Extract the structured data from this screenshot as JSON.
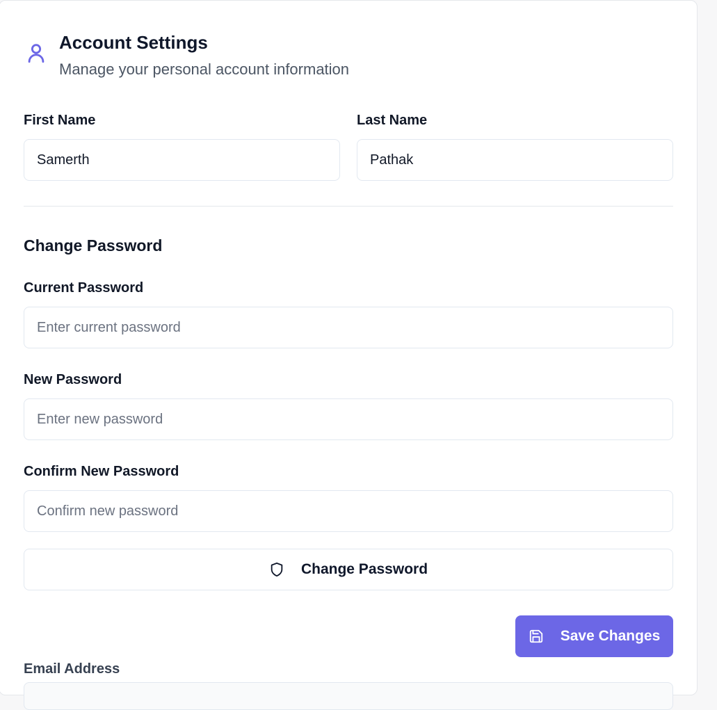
{
  "header": {
    "title": "Account Settings",
    "subtitle": "Manage your personal account information"
  },
  "name": {
    "first_label": "First Name",
    "first_value": "Samerth",
    "last_label": "Last Name",
    "last_value": "Pathak"
  },
  "password": {
    "section_title": "Change Password",
    "current_label": "Current Password",
    "current_placeholder": "Enter current password",
    "new_label": "New Password",
    "new_placeholder": "Enter new password",
    "confirm_label": "Confirm New Password",
    "confirm_placeholder": "Confirm new password",
    "button_label": "Change Password",
    "button_icon": "shield-icon"
  },
  "actions": {
    "save_label": "Save Changes",
    "save_icon": "save-icon"
  },
  "email": {
    "label": "Email Address"
  },
  "colors": {
    "accent": "#6c67e6",
    "border": "#e2e8f0"
  }
}
